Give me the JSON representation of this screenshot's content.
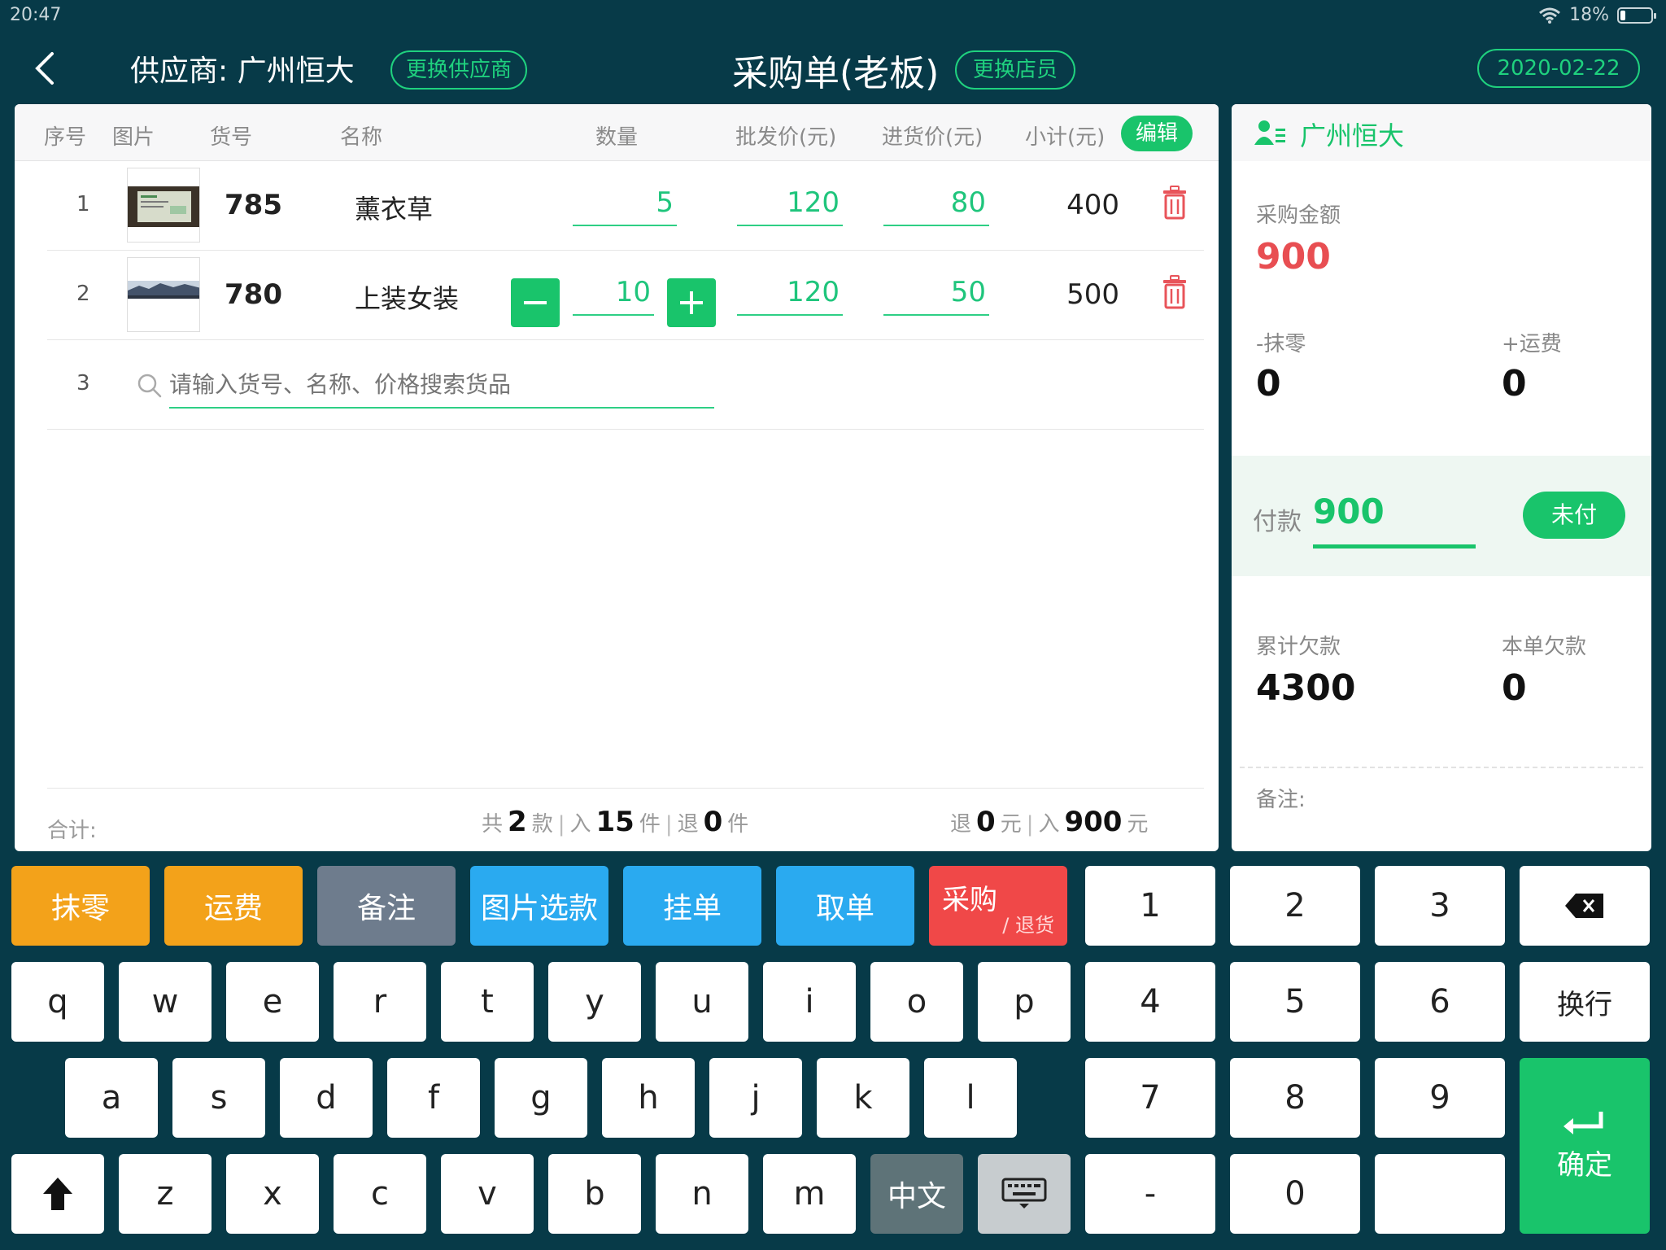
{
  "status": {
    "time": "20:47",
    "battery": "18%",
    "battery_level": 0.18
  },
  "header": {
    "supplier_label": "供应商: 广州恒大",
    "change_supplier": "更换供应商",
    "title": "采购单(老板)",
    "change_staff": "更换店员",
    "date": "2020-02-22"
  },
  "table": {
    "columns": [
      "序号",
      "图片",
      "货号",
      "名称",
      "数量",
      "批发价(元)",
      "进货价(元)",
      "小计(元)"
    ],
    "edit_label": "编辑",
    "rows": [
      {
        "index": "1",
        "code": "785",
        "name": "薰衣草",
        "qty": "5",
        "wholesale": "120",
        "purchase": "80",
        "subtotal": "400"
      },
      {
        "index": "2",
        "code": "780",
        "name": "上装女装",
        "qty": "10",
        "wholesale": "120",
        "purchase": "50",
        "subtotal": "500"
      }
    ],
    "search_index": "3",
    "search_placeholder": "请输入货号、名称、价格搜索货品"
  },
  "footer": {
    "label": "合计:",
    "total_prefix": "共",
    "styles": "2",
    "styles_unit": "款",
    "in_prefix": "入",
    "in_pieces": "15",
    "pieces_unit": "件",
    "return_prefix": "退",
    "return_pieces": "0",
    "return_amount": "0",
    "yuan_unit": "元",
    "in_amount": "900"
  },
  "summary": {
    "supplier": "广州恒大",
    "purchase_amount_label": "采购金额",
    "purchase_amount": "900",
    "rounding_label": "-抹零",
    "rounding": "0",
    "freight_label": "+运费",
    "freight": "0",
    "payment_label": "付款",
    "payment": "900",
    "payment_status": "未付",
    "total_debt_label": "累计欠款",
    "total_debt": "4300",
    "order_debt_label": "本单欠款",
    "order_debt": "0",
    "remark_label": "备注:"
  },
  "keyboard": {
    "fn": {
      "rounding": "抹零",
      "freight": "运费",
      "remark": "备注",
      "pick_image": "图片选款",
      "hold": "挂单",
      "retrieve": "取单",
      "purchase": "采购",
      "return": "/ 退货"
    },
    "row1": [
      "q",
      "w",
      "e",
      "r",
      "t",
      "y",
      "u",
      "i",
      "o",
      "p"
    ],
    "row2": [
      "a",
      "s",
      "d",
      "f",
      "g",
      "h",
      "j",
      "k",
      "l"
    ],
    "row3": [
      "z",
      "x",
      "c",
      "v",
      "b",
      "n",
      "m"
    ],
    "lang": "中文",
    "numpad": [
      "1",
      "2",
      "3",
      "4",
      "5",
      "6",
      "7",
      "8",
      "9",
      "-",
      "0"
    ],
    "newline": "换行",
    "confirm": "确定"
  }
}
